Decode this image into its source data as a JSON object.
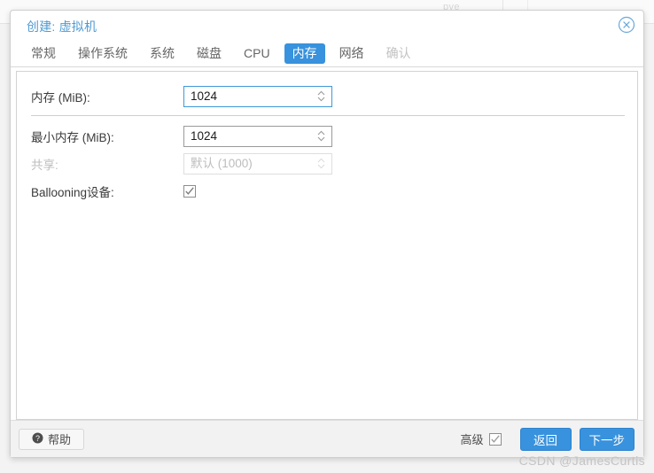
{
  "background": {
    "ghost_text": "pve"
  },
  "dialog": {
    "title": "创建: 虚拟机",
    "close_icon": "close-circle-icon",
    "tabs": [
      {
        "label": "常规",
        "state": "normal"
      },
      {
        "label": "操作系统",
        "state": "normal"
      },
      {
        "label": "系统",
        "state": "normal"
      },
      {
        "label": "磁盘",
        "state": "normal"
      },
      {
        "label": "CPU",
        "state": "normal"
      },
      {
        "label": "内存",
        "state": "active"
      },
      {
        "label": "网络",
        "state": "normal"
      },
      {
        "label": "确认",
        "state": "disabled"
      }
    ],
    "form": {
      "memory": {
        "label": "内存 (MiB):",
        "value": "1024",
        "placeholder": "",
        "disabled": false,
        "focused": true
      },
      "min_memory": {
        "label": "最小内存 (MiB):",
        "value": "1024",
        "placeholder": "",
        "disabled": false,
        "focused": false
      },
      "shares": {
        "label": "共享:",
        "value": "",
        "placeholder": "默认 (1000)",
        "disabled": true,
        "focused": false
      },
      "ballooning": {
        "label": "Ballooning设备:",
        "checked": true
      }
    },
    "footer": {
      "help_label": "帮助",
      "help_icon": "question-circle-icon",
      "advanced_label": "高级",
      "advanced_checked": true,
      "back_label": "返回",
      "next_label": "下一步"
    }
  },
  "watermark": "CSDN @JamesCurtis",
  "colors": {
    "accent": "#3892dd",
    "title": "#4e9bd4",
    "focus_border": "#3f9ad8",
    "disabled_text": "#bdbdbd",
    "watermark": "#c4c4c4"
  }
}
